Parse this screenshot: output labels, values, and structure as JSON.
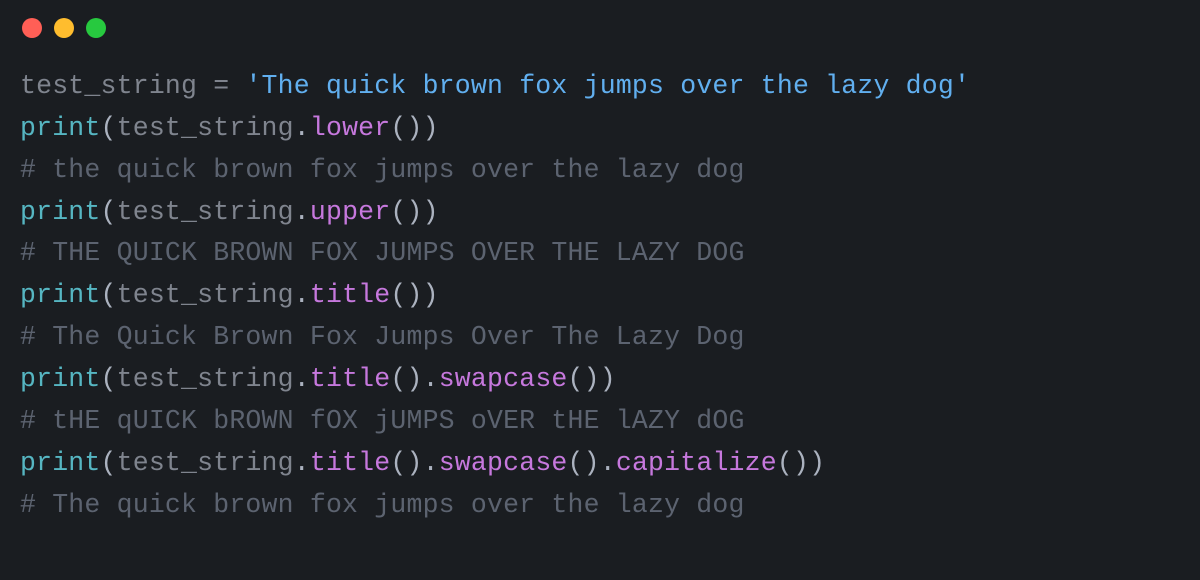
{
  "titlebar": {
    "buttons": [
      "close",
      "minimize",
      "maximize"
    ]
  },
  "code": {
    "lines": [
      {
        "segments": [
          {
            "t": "test_string ",
            "c": "tok-var"
          },
          {
            "t": "= ",
            "c": "tok-op"
          },
          {
            "t": "'The quick brown fox jumps over the lazy dog'",
            "c": "tok-str"
          }
        ]
      },
      {
        "segments": [
          {
            "t": "print",
            "c": "tok-fn"
          },
          {
            "t": "(",
            "c": "tok-punc"
          },
          {
            "t": "test_string",
            "c": "tok-var"
          },
          {
            "t": ".",
            "c": "tok-punc"
          },
          {
            "t": "lower",
            "c": "tok-method"
          },
          {
            "t": "())",
            "c": "tok-punc"
          }
        ]
      },
      {
        "segments": [
          {
            "t": "# the quick brown fox jumps over the lazy dog",
            "c": "tok-comment"
          }
        ]
      },
      {
        "segments": [
          {
            "t": "print",
            "c": "tok-fn"
          },
          {
            "t": "(",
            "c": "tok-punc"
          },
          {
            "t": "test_string",
            "c": "tok-var"
          },
          {
            "t": ".",
            "c": "tok-punc"
          },
          {
            "t": "upper",
            "c": "tok-method"
          },
          {
            "t": "())",
            "c": "tok-punc"
          }
        ]
      },
      {
        "segments": [
          {
            "t": "# THE QUICK BROWN FOX JUMPS OVER THE LAZY DOG",
            "c": "tok-comment"
          }
        ]
      },
      {
        "segments": [
          {
            "t": "print",
            "c": "tok-fn"
          },
          {
            "t": "(",
            "c": "tok-punc"
          },
          {
            "t": "test_string",
            "c": "tok-var"
          },
          {
            "t": ".",
            "c": "tok-punc"
          },
          {
            "t": "title",
            "c": "tok-method"
          },
          {
            "t": "())",
            "c": "tok-punc"
          }
        ]
      },
      {
        "segments": [
          {
            "t": "# The Quick Brown Fox Jumps Over The Lazy Dog",
            "c": "tok-comment"
          }
        ]
      },
      {
        "segments": [
          {
            "t": "print",
            "c": "tok-fn"
          },
          {
            "t": "(",
            "c": "tok-punc"
          },
          {
            "t": "test_string",
            "c": "tok-var"
          },
          {
            "t": ".",
            "c": "tok-punc"
          },
          {
            "t": "title",
            "c": "tok-method"
          },
          {
            "t": "().",
            "c": "tok-punc"
          },
          {
            "t": "swapcase",
            "c": "tok-method"
          },
          {
            "t": "())",
            "c": "tok-punc"
          }
        ]
      },
      {
        "segments": [
          {
            "t": "# tHE qUICK bROWN fOX jUMPS oVER tHE lAZY dOG",
            "c": "tok-comment"
          }
        ]
      },
      {
        "segments": [
          {
            "t": "print",
            "c": "tok-fn"
          },
          {
            "t": "(",
            "c": "tok-punc"
          },
          {
            "t": "test_string",
            "c": "tok-var"
          },
          {
            "t": ".",
            "c": "tok-punc"
          },
          {
            "t": "title",
            "c": "tok-method"
          },
          {
            "t": "().",
            "c": "tok-punc"
          },
          {
            "t": "swapcase",
            "c": "tok-method"
          },
          {
            "t": "().",
            "c": "tok-punc"
          },
          {
            "t": "capitalize",
            "c": "tok-method"
          },
          {
            "t": "())",
            "c": "tok-punc"
          }
        ]
      },
      {
        "segments": [
          {
            "t": "# The quick brown fox jumps over the lazy dog",
            "c": "tok-comment"
          }
        ]
      }
    ]
  }
}
